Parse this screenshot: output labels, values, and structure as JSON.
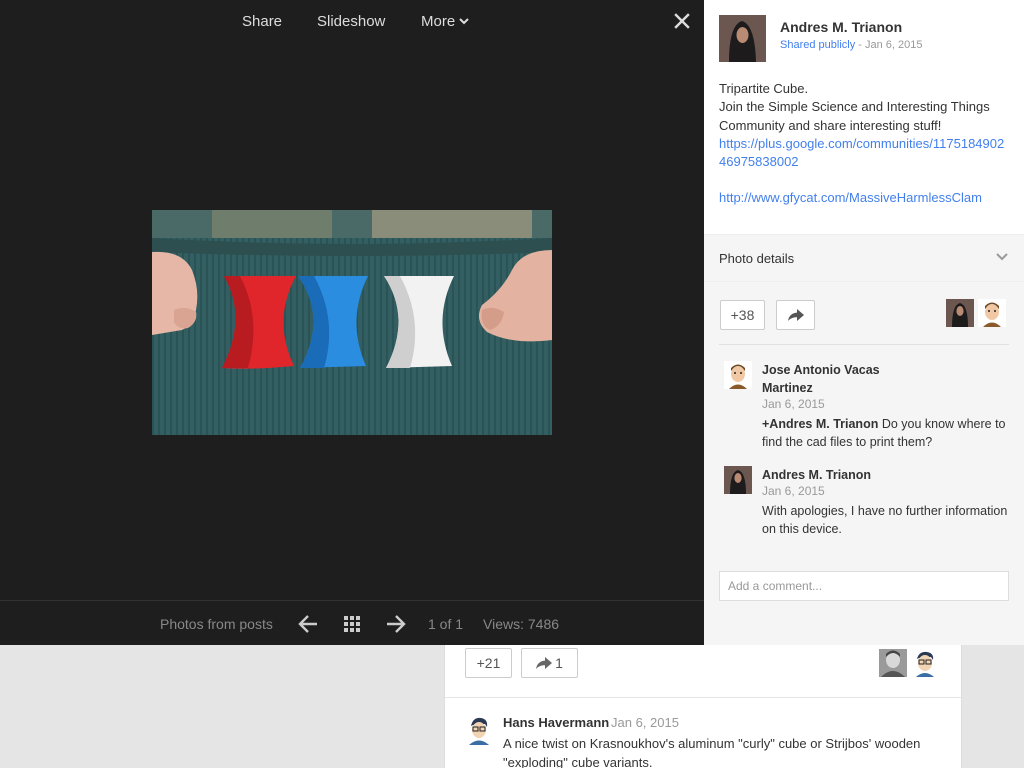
{
  "toolbar": {
    "share_label": "Share",
    "slideshow_label": "Slideshow",
    "more_label": "More",
    "close_icon": "close-icon"
  },
  "photo": {
    "subject": "three twisted 3D-printed cubes: red, blue, white"
  },
  "bottom_bar": {
    "photos_from_label": "Photos from posts",
    "counter": "1 of 1",
    "views": "Views: 7486"
  },
  "post": {
    "author": "Andres M. Trianon",
    "visibility": "Shared publicly",
    "separator": "-",
    "date": "Jan 6, 2015",
    "line1": "Tripartite Cube.",
    "line2": "Join the Simple Science and Interesting Things Community and share interesting stuff!",
    "link1": "https://plus.google.com/communities/117518490246975838002",
    "link2": "http://www.gfycat.com/MassiveHarmlessClam"
  },
  "details": {
    "label": "Photo details"
  },
  "social": {
    "plus_count": "+38"
  },
  "comments": [
    {
      "author": "Jose Antonio Vacas Martinez",
      "date": "Jan 6, 2015",
      "mention": "+Andres M. Trianon",
      "text": " Do you know where to find the cad files to print them?"
    },
    {
      "author": "Andres M. Trianon",
      "date": "Jan 6, 2015",
      "text": "With apologies, I have no further information on this device."
    }
  ],
  "comment_input": {
    "placeholder": "Add a comment..."
  },
  "background_post": {
    "plus_count": "+21",
    "reshare_count": "1",
    "comment": {
      "author": "Hans Havermann",
      "date": "Jan 6, 2015",
      "text": "A nice twist on Krasnoukhov's aluminum \"curly\" cube or Strijbos' wooden \"exploding\" cube variants."
    }
  },
  "colors": {
    "lightbox_bg": "#1e1e1e",
    "link_blue": "#427fed",
    "panel_gray": "#f5f5f5",
    "cube_red": "#e0262b",
    "cube_blue": "#2a8de0",
    "cube_white": "#f2f2f2"
  }
}
